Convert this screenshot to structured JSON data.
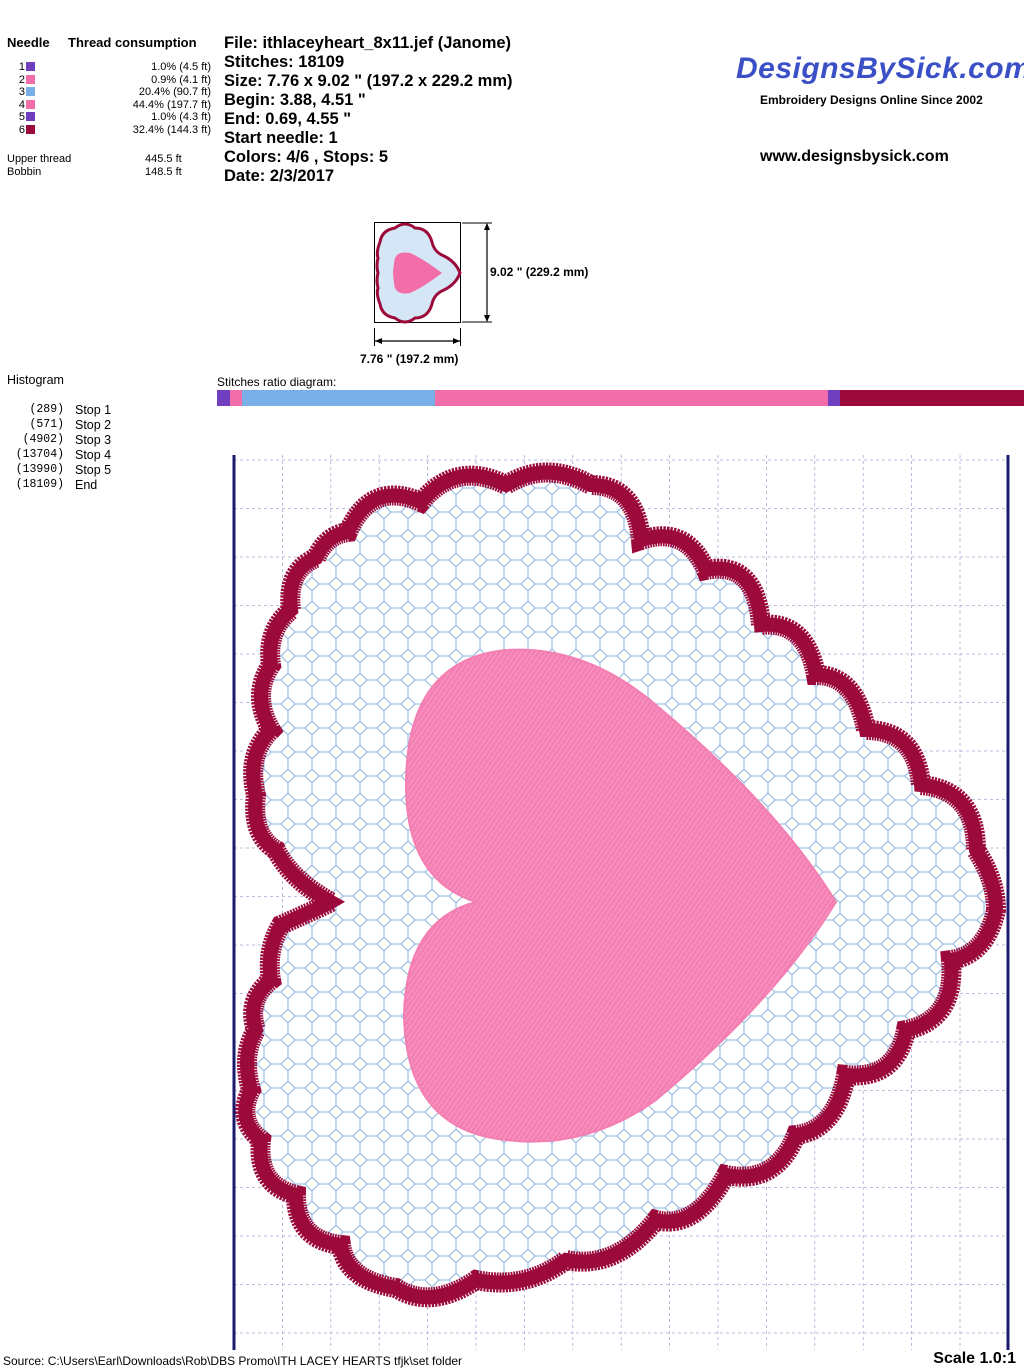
{
  "needle_table": {
    "col_needle": "Needle",
    "col_thread": "Thread consumption",
    "rows": [
      {
        "needle": "1",
        "color": "#6f3fbf",
        "consumption": "1.0% (4.5 ft)"
      },
      {
        "needle": "2",
        "color": "#f26ea8",
        "consumption": "0.9% (4.1 ft)"
      },
      {
        "needle": "3",
        "color": "#7aaee6",
        "consumption": "20.4% (90.7 ft)"
      },
      {
        "needle": "4",
        "color": "#f26ea8",
        "consumption": "44.4% (197.7 ft)"
      },
      {
        "needle": "5",
        "color": "#6f3fbf",
        "consumption": "1.0% (4.3 ft)"
      },
      {
        "needle": "6",
        "color": "#9b0a3a",
        "consumption": "32.4% (144.3 ft)"
      }
    ],
    "upper_thread_label": "Upper thread",
    "upper_thread_value": "445.5 ft",
    "bobbin_label": "Bobbin",
    "bobbin_value": "148.5 ft"
  },
  "file_info": {
    "file": "File: ithlaceyheart_8x11.jef  (Janome)",
    "stitches": "Stitches: 18109",
    "size": "Size: 7.76 x 9.02 \" (197.2 x 229.2 mm)",
    "begin": "Begin: 3.88, 4.51 \"",
    "end": "End: 0.69, 4.55 \"",
    "start_needle": "Start needle: 1",
    "colors": "Colors: 4/6 , Stops: 5",
    "date": "Date: 2/3/2017"
  },
  "brand": {
    "logo_text": "DesignsBySick.com",
    "tagline": "Embroidery Designs Online Since 2002",
    "url": "www.designsbysick.com"
  },
  "preview": {
    "height_label": "9.02 \" (229.2 mm)",
    "width_label": "7.76 \" (197.2 mm)"
  },
  "histogram": {
    "title": "Histogram",
    "rows": [
      {
        "count": "(289)",
        "label": "Stop 1"
      },
      {
        "count": "(571)",
        "label": "Stop 2"
      },
      {
        "count": "(4902)",
        "label": "Stop 3"
      },
      {
        "count": "(13704)",
        "label": "Stop 4"
      },
      {
        "count": "(13990)",
        "label": "Stop 5"
      },
      {
        "count": "(18109)",
        "label": "End"
      }
    ]
  },
  "ratio": {
    "title": "Stitches ratio diagram:",
    "segments": [
      {
        "color": "#6f3fbf",
        "stitches": 289
      },
      {
        "color": "#f26ea8",
        "stitches": 282
      },
      {
        "color": "#7aaee6",
        "stitches": 4331
      },
      {
        "color": "#f26ea8",
        "stitches": 8802
      },
      {
        "color": "#6f3fbf",
        "stitches": 286
      },
      {
        "color": "#9b0a3a",
        "stitches": 4119
      }
    ]
  },
  "colors": {
    "border": "#9b0a3a",
    "heart": "#f47fb3",
    "lace": "#8ab4e0",
    "grid": "#a9a9d6",
    "frame": "#1a1a6e",
    "brand": "#3b4fc6"
  },
  "footer": {
    "source": "Source: C:\\Users\\Earl\\Downloads\\Rob\\DBS Promo\\ITH LACEY HEARTS  tfjk\\set folder",
    "scale": "Scale 1.0:1"
  }
}
